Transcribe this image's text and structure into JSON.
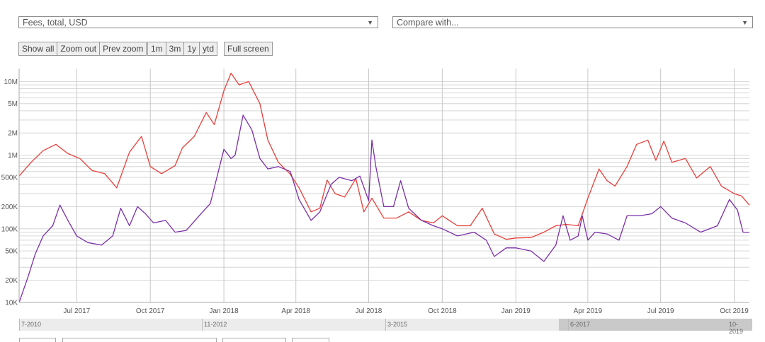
{
  "controls": {
    "metric_select": "Fees, total, USD",
    "compare_select": "Compare with...",
    "buttons": [
      "Show all",
      "Zoom out",
      "Prev zoom"
    ],
    "ranges": [
      "1m",
      "3m",
      "1y",
      "ytd"
    ],
    "fullscreen": "Full screen",
    "dropdown_arrow": "▼"
  },
  "colors": {
    "series_1": "#e8403a",
    "series_2": "#7b2fa8",
    "grid": "#d6d6d6",
    "vgrid": "#c8c8c8"
  },
  "navigator": {
    "labels": [
      "7-2010",
      "11-2012",
      "3-2015",
      "6-2017",
      "10-2019"
    ]
  },
  "chart_data": {
    "type": "line",
    "y_scale": "log",
    "ylim": [
      10000,
      15000000
    ],
    "yticks": [
      {
        "value": 10000,
        "label": "10K"
      },
      {
        "value": 20000,
        "label": "20K"
      },
      {
        "value": 50000,
        "label": "50K"
      },
      {
        "value": 100000,
        "label": "100K"
      },
      {
        "value": 200000,
        "label": "200K"
      },
      {
        "value": 500000,
        "label": "500K"
      },
      {
        "value": 1000000,
        "label": "1M"
      },
      {
        "value": 2000000,
        "label": "2M"
      },
      {
        "value": 5000000,
        "label": "5M"
      },
      {
        "value": 10000000,
        "label": "10M"
      }
    ],
    "xlim": [
      "2017-04-20",
      "2019-10-20"
    ],
    "xticks": [
      {
        "date": "2017-07-01",
        "label": "Jul 2017"
      },
      {
        "date": "2017-10-01",
        "label": "Oct 2017"
      },
      {
        "date": "2018-01-01",
        "label": "Jan 2018"
      },
      {
        "date": "2018-04-01",
        "label": "Apr 2018"
      },
      {
        "date": "2018-07-01",
        "label": "Jul 2018"
      },
      {
        "date": "2018-10-01",
        "label": "Oct 2018"
      },
      {
        "date": "2019-01-01",
        "label": "Jan 2019"
      },
      {
        "date": "2019-04-01",
        "label": "Apr 2019"
      },
      {
        "date": "2019-07-01",
        "label": "Jul 2019"
      },
      {
        "date": "2019-10-01",
        "label": "Oct 2019"
      }
    ],
    "series": [
      {
        "color": "#e8403a",
        "points": [
          [
            "2017-04-20",
            520000
          ],
          [
            "2017-05-05",
            800000
          ],
          [
            "2017-05-20",
            1150000
          ],
          [
            "2017-06-05",
            1400000
          ],
          [
            "2017-06-20",
            1050000
          ],
          [
            "2017-07-05",
            900000
          ],
          [
            "2017-07-20",
            620000
          ],
          [
            "2017-08-05",
            560000
          ],
          [
            "2017-08-20",
            360000
          ],
          [
            "2017-09-05",
            1100000
          ],
          [
            "2017-09-20",
            1800000
          ],
          [
            "2017-10-01",
            700000
          ],
          [
            "2017-10-15",
            560000
          ],
          [
            "2017-11-01",
            720000
          ],
          [
            "2017-11-10",
            1250000
          ],
          [
            "2017-11-25",
            1800000
          ],
          [
            "2017-12-10",
            3800000
          ],
          [
            "2017-12-20",
            2600000
          ],
          [
            "2018-01-01",
            7500000
          ],
          [
            "2018-01-10",
            13000000
          ],
          [
            "2018-01-20",
            9000000
          ],
          [
            "2018-02-01",
            10000000
          ],
          [
            "2018-02-15",
            5000000
          ],
          [
            "2018-02-25",
            1600000
          ],
          [
            "2018-03-10",
            800000
          ],
          [
            "2018-03-25",
            550000
          ],
          [
            "2018-04-05",
            360000
          ],
          [
            "2018-04-20",
            170000
          ],
          [
            "2018-05-01",
            190000
          ],
          [
            "2018-05-10",
            460000
          ],
          [
            "2018-05-20",
            300000
          ],
          [
            "2018-06-01",
            270000
          ],
          [
            "2018-06-15",
            480000
          ],
          [
            "2018-06-25",
            170000
          ],
          [
            "2018-07-05",
            260000
          ],
          [
            "2018-07-20",
            140000
          ],
          [
            "2018-08-05",
            140000
          ],
          [
            "2018-08-20",
            170000
          ],
          [
            "2018-09-05",
            130000
          ],
          [
            "2018-09-20",
            120000
          ],
          [
            "2018-10-01",
            150000
          ],
          [
            "2018-10-20",
            110000
          ],
          [
            "2018-11-05",
            110000
          ],
          [
            "2018-11-20",
            190000
          ],
          [
            "2018-12-05",
            85000
          ],
          [
            "2018-12-20",
            72000
          ],
          [
            "2019-01-01",
            75000
          ],
          [
            "2019-01-20",
            76000
          ],
          [
            "2019-02-05",
            90000
          ],
          [
            "2019-02-20",
            110000
          ],
          [
            "2019-03-05",
            115000
          ],
          [
            "2019-03-20",
            110000
          ],
          [
            "2019-04-01",
            260000
          ],
          [
            "2019-04-15",
            650000
          ],
          [
            "2019-04-25",
            450000
          ],
          [
            "2019-05-05",
            380000
          ],
          [
            "2019-05-20",
            700000
          ],
          [
            "2019-06-01",
            1400000
          ],
          [
            "2019-06-15",
            1600000
          ],
          [
            "2019-06-25",
            850000
          ],
          [
            "2019-07-05",
            1550000
          ],
          [
            "2019-07-15",
            800000
          ],
          [
            "2019-08-01",
            900000
          ],
          [
            "2019-08-15",
            490000
          ],
          [
            "2019-09-01",
            700000
          ],
          [
            "2019-09-15",
            380000
          ],
          [
            "2019-10-01",
            300000
          ],
          [
            "2019-10-10",
            280000
          ],
          [
            "2019-10-20",
            210000
          ]
        ]
      },
      {
        "color": "#7b2fa8",
        "points": [
          [
            "2017-04-20",
            10000
          ],
          [
            "2017-05-01",
            22000
          ],
          [
            "2017-05-10",
            45000
          ],
          [
            "2017-05-20",
            80000
          ],
          [
            "2017-06-01",
            110000
          ],
          [
            "2017-06-10",
            210000
          ],
          [
            "2017-06-20",
            130000
          ],
          [
            "2017-07-01",
            80000
          ],
          [
            "2017-07-15",
            65000
          ],
          [
            "2017-08-01",
            60000
          ],
          [
            "2017-08-15",
            80000
          ],
          [
            "2017-08-25",
            190000
          ],
          [
            "2017-09-05",
            110000
          ],
          [
            "2017-09-15",
            200000
          ],
          [
            "2017-09-25",
            160000
          ],
          [
            "2017-10-05",
            120000
          ],
          [
            "2017-10-20",
            130000
          ],
          [
            "2017-11-01",
            90000
          ],
          [
            "2017-11-15",
            95000
          ],
          [
            "2017-12-01",
            150000
          ],
          [
            "2017-12-15",
            220000
          ],
          [
            "2018-01-01",
            1200000
          ],
          [
            "2018-01-10",
            900000
          ],
          [
            "2018-01-15",
            1000000
          ],
          [
            "2018-01-25",
            3500000
          ],
          [
            "2018-02-05",
            2200000
          ],
          [
            "2018-02-15",
            900000
          ],
          [
            "2018-02-25",
            650000
          ],
          [
            "2018-03-10",
            700000
          ],
          [
            "2018-03-25",
            600000
          ],
          [
            "2018-04-05",
            250000
          ],
          [
            "2018-04-20",
            130000
          ],
          [
            "2018-05-01",
            170000
          ],
          [
            "2018-05-15",
            400000
          ],
          [
            "2018-05-25",
            500000
          ],
          [
            "2018-06-10",
            450000
          ],
          [
            "2018-06-20",
            520000
          ],
          [
            "2018-07-01",
            240000
          ],
          [
            "2018-07-05",
            1600000
          ],
          [
            "2018-07-10",
            700000
          ],
          [
            "2018-07-20",
            200000
          ],
          [
            "2018-08-01",
            200000
          ],
          [
            "2018-08-10",
            450000
          ],
          [
            "2018-08-20",
            190000
          ],
          [
            "2018-09-05",
            130000
          ],
          [
            "2018-09-20",
            110000
          ],
          [
            "2018-10-01",
            100000
          ],
          [
            "2018-10-20",
            80000
          ],
          [
            "2018-11-10",
            90000
          ],
          [
            "2018-11-25",
            70000
          ],
          [
            "2018-12-05",
            42000
          ],
          [
            "2018-12-20",
            55000
          ],
          [
            "2019-01-01",
            55000
          ],
          [
            "2019-01-20",
            50000
          ],
          [
            "2019-02-05",
            36000
          ],
          [
            "2019-02-20",
            60000
          ],
          [
            "2019-03-01",
            150000
          ],
          [
            "2019-03-10",
            70000
          ],
          [
            "2019-03-20",
            80000
          ],
          [
            "2019-03-25",
            150000
          ],
          [
            "2019-04-01",
            70000
          ],
          [
            "2019-04-10",
            90000
          ],
          [
            "2019-04-25",
            85000
          ],
          [
            "2019-05-10",
            70000
          ],
          [
            "2019-05-20",
            150000
          ],
          [
            "2019-06-05",
            150000
          ],
          [
            "2019-06-20",
            160000
          ],
          [
            "2019-07-01",
            200000
          ],
          [
            "2019-07-15",
            140000
          ],
          [
            "2019-08-01",
            120000
          ],
          [
            "2019-08-20",
            90000
          ],
          [
            "2019-09-10",
            110000
          ],
          [
            "2019-09-25",
            250000
          ],
          [
            "2019-10-05",
            180000
          ],
          [
            "2019-10-12",
            90000
          ],
          [
            "2019-10-20",
            90000
          ]
        ]
      }
    ]
  }
}
